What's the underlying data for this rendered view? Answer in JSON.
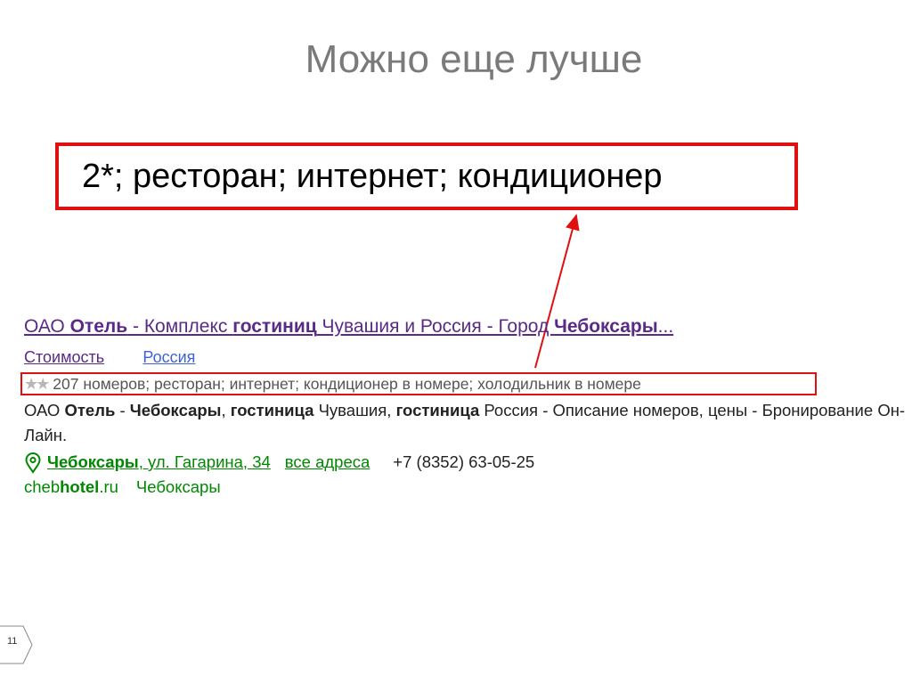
{
  "slide": {
    "title": "Можно еще лучше",
    "callout": "2*; ресторан; интернет; кондиционер",
    "page_number": "11"
  },
  "result": {
    "title_parts": [
      "ОАО ",
      "Отель",
      " - Комплекс ",
      "гостиниц",
      " Чувашия и Россия - Город ",
      "Чебоксары",
      "..."
    ],
    "sitelinks": [
      "Стоимость",
      "Россия"
    ],
    "stars_icon": "two-star-rating-icon",
    "facts": "207 номеров; ресторан; интернет; кондиционер в номере; холодильник в номере",
    "snippet_parts": [
      "ОАО ",
      "Отель",
      " - ",
      "Чебоксары",
      ", ",
      "гостиница",
      " Чувашия, ",
      "гостиница",
      " Россия - Описание номеров, цены - Бронирование Он-Лайн."
    ],
    "address_parts": [
      "Чебоксары",
      ", ул. Гагарина, 34"
    ],
    "all_addresses": "все адреса",
    "phone": "+7 (8352) 63-05-25",
    "url_parts": [
      "cheb",
      "hotel",
      ".ru"
    ],
    "url_region": "Чебоксары"
  },
  "colors": {
    "accent_red": "#e01010",
    "title_purple": "#5a2a87",
    "link_blue": "#3d63d6",
    "url_green": "#008800",
    "heading_gray": "#7a7a7a"
  }
}
